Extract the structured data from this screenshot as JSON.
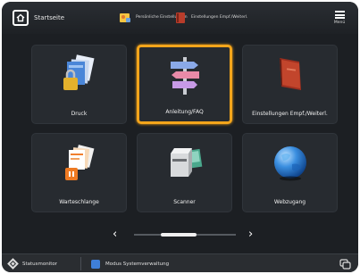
{
  "topbar": {
    "home_label": "Startseite",
    "shortcut1_label": "Persönliche Einstellungen",
    "shortcut2_label": "Einstellungen Empf./Weiterl.",
    "menu_label": "Menü"
  },
  "tiles": [
    {
      "label": "Druck",
      "icon": "print-icon"
    },
    {
      "label": "Anleitung/FAQ",
      "icon": "signpost-icon",
      "selected": true
    },
    {
      "label": "Einstellungen Empf./Weiterl.",
      "icon": "book-icon"
    },
    {
      "label": "Warteschlange",
      "icon": "print-queue-icon"
    },
    {
      "label": "Scanner",
      "icon": "scanner-icon"
    },
    {
      "label": "Webzugang",
      "icon": "globe-icon"
    }
  ],
  "pager": {
    "prev": "‹",
    "next": "›"
  },
  "bottombar": {
    "status_label": "Statusmonitor",
    "mode_label": "Modus Systemverwaltung"
  },
  "colors": {
    "selected_border": "#f4a51b",
    "background": "#1c1f23",
    "tile": "#272b30"
  }
}
